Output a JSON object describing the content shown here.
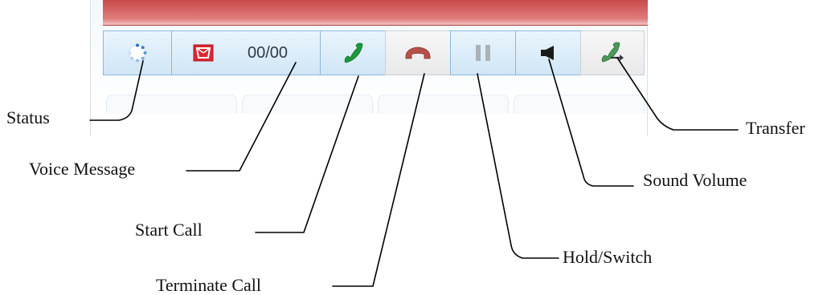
{
  "toolbar": {
    "voice_message_count": "00/00",
    "buttons": [
      {
        "id": "status",
        "icon": "status-spinner-icon",
        "color": "#3a7fd0"
      },
      {
        "id": "voice-message",
        "icon": "envelope-icon",
        "color": "#e0252f"
      },
      {
        "id": "start-call",
        "icon": "phone-handset-icon",
        "color": "#1c9a3a"
      },
      {
        "id": "terminate-call",
        "icon": "hang-up-icon",
        "color": "#b5514a"
      },
      {
        "id": "hold-switch",
        "icon": "pause-icon",
        "color": "#a9b3b8"
      },
      {
        "id": "sound-volume",
        "icon": "speaker-icon",
        "color": "#1a1a1a"
      },
      {
        "id": "transfer",
        "icon": "transfer-call-icon",
        "color": "#4a9a5a"
      }
    ]
  },
  "labels": {
    "status": "Status",
    "voice_message": "Voice Message",
    "start_call": "Start Call",
    "terminate_call": "Terminate Call",
    "hold_switch": "Hold/Switch",
    "sound_volume": "Sound Volume",
    "transfer": "Transfer"
  }
}
